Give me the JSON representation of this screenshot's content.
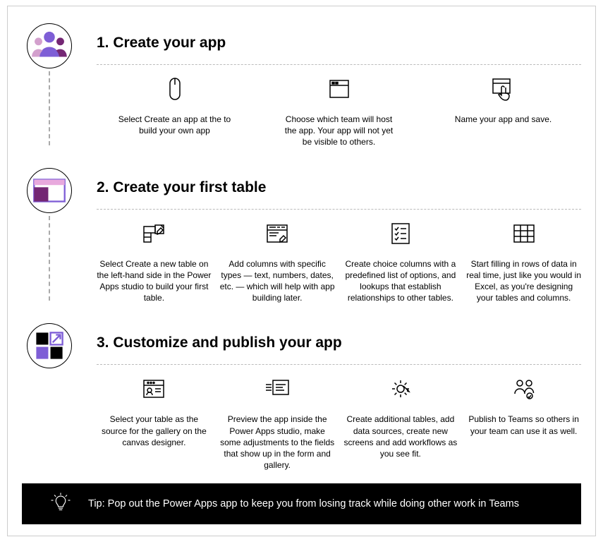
{
  "s1": {
    "title": "1. Create your app",
    "i1": "Select Create an app at the to build your own app",
    "i2": "Choose which team will host the app. Your app will not yet be visible to others.",
    "i3": "Name your app and save."
  },
  "s2": {
    "title": "2. Create your first table",
    "i1": "Select Create a new table on the left-hand side in the Power Apps studio to build your first table.",
    "i2": "Add columns with specific types — text, numbers, dates, etc. — which will help with app building later.",
    "i3": "Create choice columns with a predefined list of options, and lookups that establish relationships to other tables.",
    "i4": "Start filling in rows of data in real time, just like you would in Excel, as you're designing your tables and columns."
  },
  "s3": {
    "title": "3. Customize and publish your app",
    "i1": "Select your table as the source for the gallery on the canvas designer.",
    "i2": "Preview the app inside the Power Apps studio, make some adjustments to the fields that show up in the form and gallery.",
    "i3": "Create additional tables, add data sources, create new screens and add workflows as you see fit.",
    "i4": "Publish to Teams so others in your team can use it as well."
  },
  "tip": "Tip: Pop out the Power Apps app to keep you from losing track while doing other work in Teams"
}
